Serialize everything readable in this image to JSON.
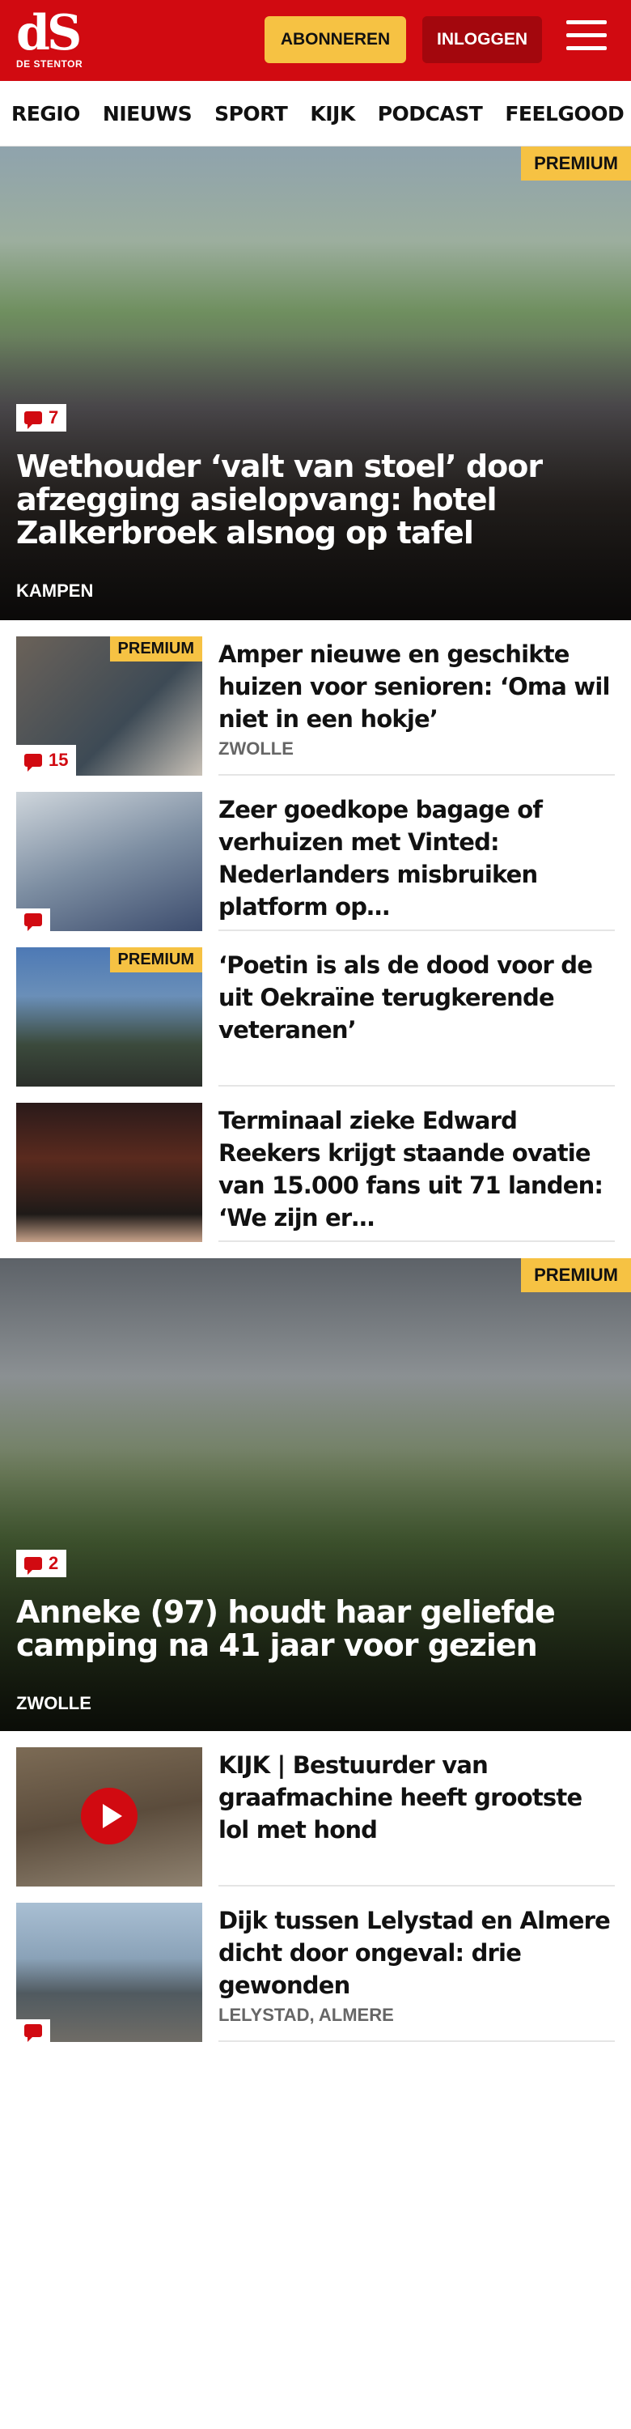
{
  "header": {
    "logo_mark": "dS",
    "logo_sub": "DE STENTOR",
    "subscribe_label": "ABONNEREN",
    "login_label": "INLOGGEN"
  },
  "nav": {
    "items": [
      "REGIO",
      "NIEUWS",
      "SPORT",
      "KIJK",
      "PODCAST",
      "FEELGOOD"
    ],
    "more": "I"
  },
  "hero1": {
    "premium": "PREMIUM",
    "comments": "7",
    "title": "Wethouder ‘valt van stoel’ door afzegging asielopvang: hotel Zalker­broek alsnog op tafel",
    "region": "KAMPEN"
  },
  "articles": [
    {
      "premium": "PREMIUM",
      "comments": "15",
      "title": "Amper nieuwe en geschikte huizen voor senioren: ‘Oma wil niet in een hokje’",
      "region": "ZWOLLE"
    },
    {
      "premium": "",
      "comments": "",
      "title": "Zeer goedkope bagage of verhuizen met Vinted: Nederlan­ders misbruiken platform op…",
      "region": ""
    },
    {
      "premium": "PREMIUM",
      "comments": "",
      "title": "‘Poetin is als de dood voor de uit Oekraïne terugkerende veteranen’",
      "region": ""
    },
    {
      "premium": "",
      "comments": "",
      "title": "Terminaal zieke Edward Reekers krijgt staande ovatie van 15.000 fans uit 71 landen: ‘We zijn er…",
      "region": ""
    }
  ],
  "hero2": {
    "premium": "PREMIUM",
    "comments": "2",
    "title": "Anneke (97) houdt haar geliefde camping na 41 jaar voor gezien",
    "region": "ZWOLLE"
  },
  "articles2": [
    {
      "title": "KIJK | Bestuurder van graafmachine heeft grootste lol met hond",
      "region": ""
    },
    {
      "title": "Dijk tussen Lelystad en Almere dicht door ongeval: drie gewonden",
      "region": "LELYSTAD, ALMERE"
    }
  ],
  "colors": {
    "brand": "#d10a11",
    "premium": "#f6c243",
    "login": "#a3070d"
  }
}
